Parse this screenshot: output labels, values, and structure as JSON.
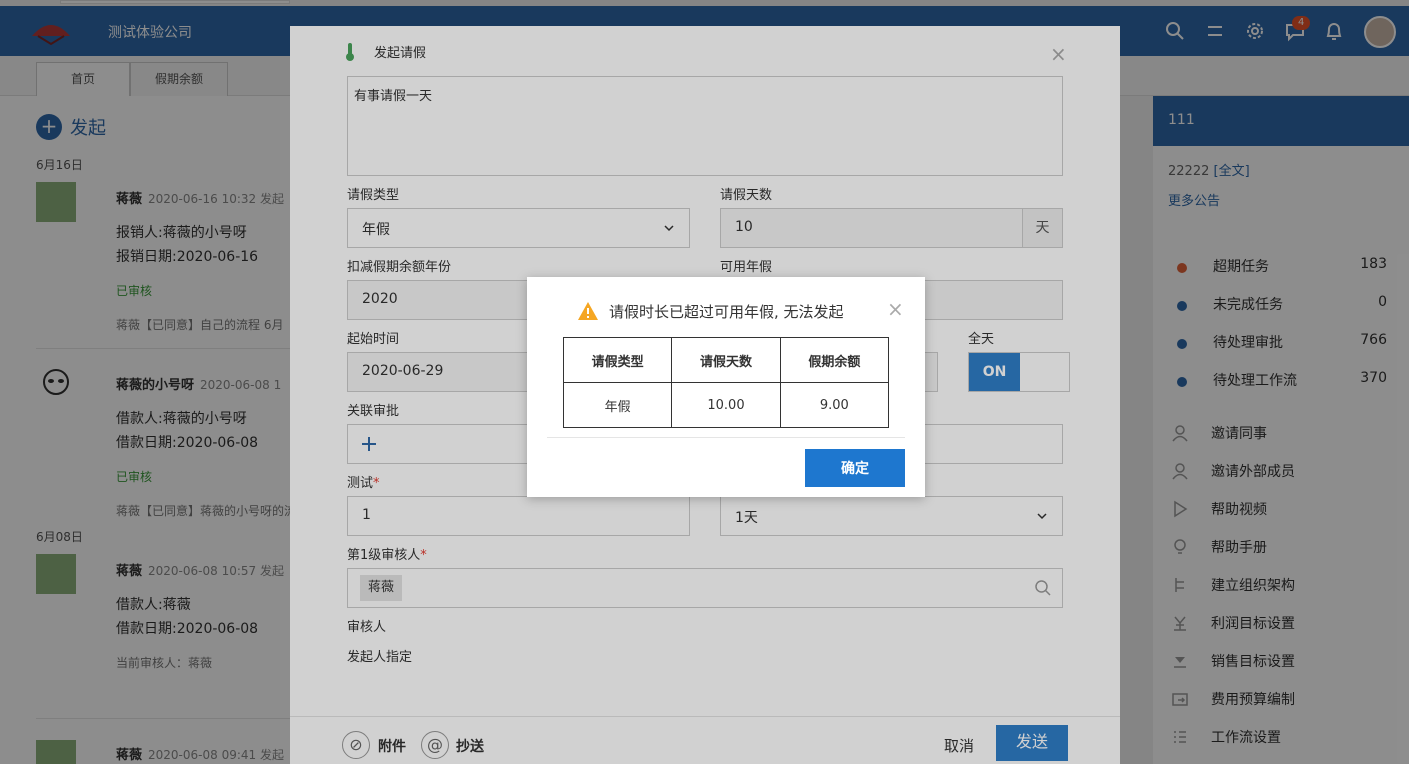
{
  "header": {
    "company": "测试体验公司",
    "notification_count": "4"
  },
  "tabs": [
    {
      "label": "首页"
    },
    {
      "label": "假期余额"
    }
  ],
  "feed": {
    "launch_label": "发起",
    "dates": [
      "6月16日",
      "6月08日"
    ],
    "items": [
      {
        "name": "蒋薇",
        "meta": "2020-06-16 10:32 发起",
        "line1": "报销人:蒋薇的小号呀",
        "line2": "报销日期:2020-06-16",
        "status": "已审核",
        "note": "蒋薇【已同意】自己的流程  6月"
      },
      {
        "name": "蒋薇的小号呀",
        "meta": "2020-06-08 1",
        "line1": "借款人:蒋薇的小号呀",
        "line2": "借款日期:2020-06-08",
        "status": "已审核",
        "note": "蒋薇【已同意】蒋薇的小号呀的流"
      },
      {
        "name": "蒋薇",
        "meta": "2020-06-08 10:57 发起",
        "line1": "借款人:蒋薇",
        "line2": "借款日期:2020-06-08",
        "note": "当前审核人：蒋薇"
      },
      {
        "name": "蒋薇",
        "meta": "2020-06-08 09:41 发起"
      }
    ]
  },
  "sidebar": {
    "notice_title": "111",
    "notice_text": "22222",
    "notice_link": "[全文]",
    "more": "更多公告",
    "tasks": [
      {
        "label": "超期任务",
        "count": "183",
        "color": "#e0623a"
      },
      {
        "label": "未完成任务",
        "count": "0",
        "color": "#2f68a8"
      },
      {
        "label": "待处理审批",
        "count": "766",
        "color": "#2f68a8"
      },
      {
        "label": "待处理工作流",
        "count": "370",
        "color": "#2f68a8"
      }
    ],
    "links": [
      {
        "label": "邀请同事"
      },
      {
        "label": "邀请外部成员"
      },
      {
        "label": "帮助视频"
      },
      {
        "label": "帮助手册"
      },
      {
        "label": "建立组织架构"
      },
      {
        "label": "利润目标设置"
      },
      {
        "label": "销售目标设置"
      },
      {
        "label": "费用预算编制"
      },
      {
        "label": "工作流设置"
      }
    ]
  },
  "leave_form": {
    "title": "发起请假",
    "reason": "有事请假一天",
    "type_label": "请假类型",
    "type_value": "年假",
    "days_label": "请假天数",
    "days_value": "10",
    "days_unit": "天",
    "year_label": "扣减假期余额年份",
    "year_value": "2020",
    "available_label": "可用年假",
    "start_label": "起始时间",
    "start_value": "2020-06-29",
    "allday_label": "全天",
    "toggle_on": "ON",
    "related_label": "关联审批",
    "test_label": "测试",
    "test_value": "1",
    "duration_value": "1天",
    "approver_label": "第1级审核人",
    "approver_tag": "蒋薇",
    "reviewer_label": "审核人",
    "reviewer_value": "发起人指定",
    "attach_label": "附件",
    "cc_label": "抄送",
    "cancel_label": "取消",
    "send_label": "发送"
  },
  "alert": {
    "message": "请假时长已超过可用年假, 无法发起",
    "headers": [
      "请假类型",
      "请假天数",
      "假期余额"
    ],
    "row": [
      "年假",
      "10.00",
      "9.00"
    ],
    "ok_label": "确定"
  }
}
